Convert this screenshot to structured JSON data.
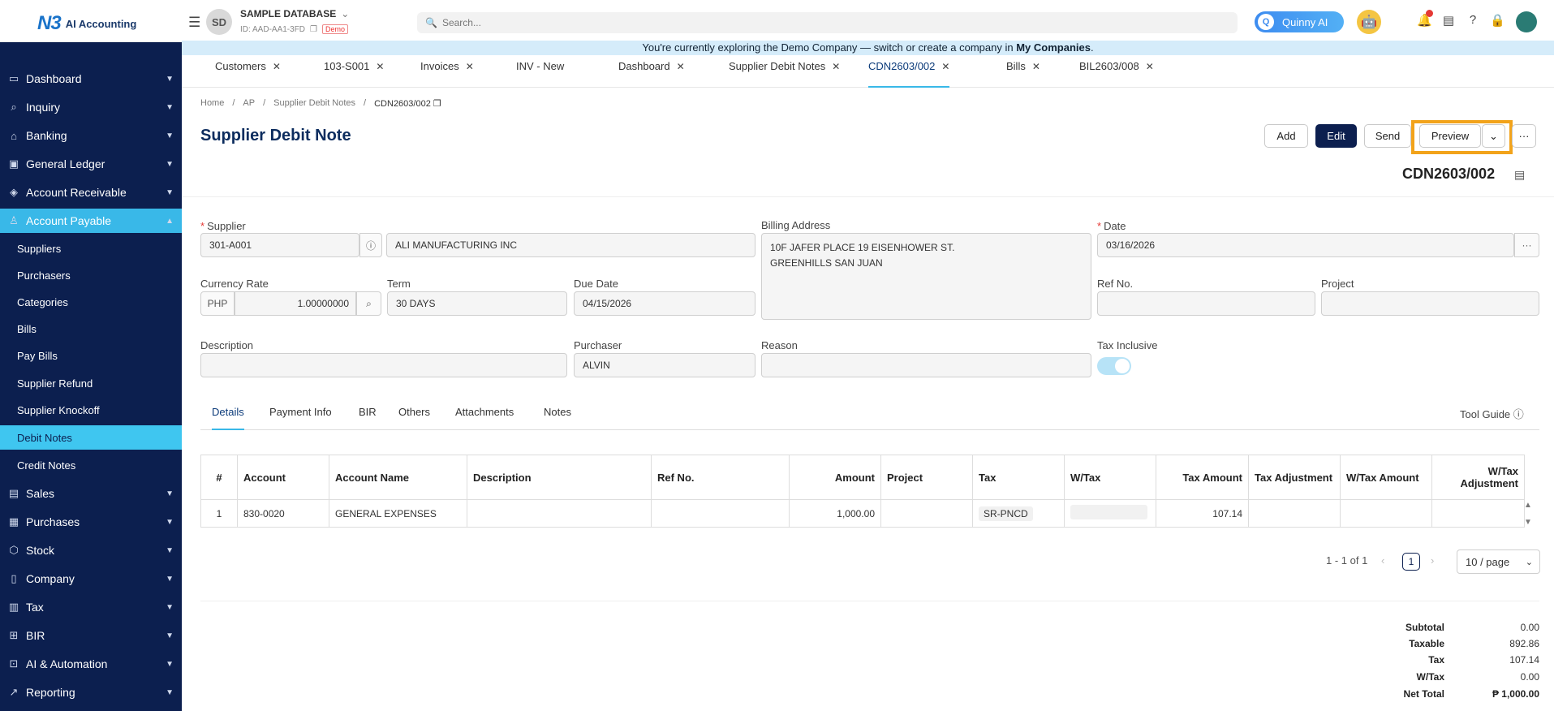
{
  "app": {
    "logo_mark": "N3",
    "logo_text": "AI Accounting"
  },
  "database": {
    "initials": "SD",
    "name": "SAMPLE DATABASE",
    "id": "ID: AAD-AA1-3FD",
    "demo_badge": "Demo"
  },
  "search": {
    "placeholder": "Search..."
  },
  "quinny": {
    "label": "Quinny AI"
  },
  "banner": {
    "text": "You're currently exploring the Demo Company — switch or create a company in ",
    "link": "My Companies",
    "suffix": "."
  },
  "tabs": [
    {
      "label": "Customers",
      "closable": true
    },
    {
      "label": "103-S001",
      "closable": true
    },
    {
      "label": "Invoices",
      "closable": true
    },
    {
      "label": "INV - New",
      "closable": false
    },
    {
      "label": "Dashboard",
      "closable": true
    },
    {
      "label": "Supplier Debit Notes",
      "closable": true
    },
    {
      "label": "CDN2603/002",
      "closable": true,
      "active": true
    },
    {
      "label": "Bills",
      "closable": true
    },
    {
      "label": "BIL2603/008",
      "closable": true
    }
  ],
  "tab_close": "✕",
  "sidebar": {
    "items": [
      {
        "label": "Dashboard",
        "icon": "monitor-icon"
      },
      {
        "label": "Inquiry",
        "icon": "inquiry-icon"
      },
      {
        "label": "Banking",
        "icon": "bank-icon"
      },
      {
        "label": "General Ledger",
        "icon": "ledger-icon"
      },
      {
        "label": "Account Receivable",
        "icon": "receivable-icon"
      },
      {
        "label": "Account Payable",
        "icon": "user-icon",
        "active": true
      },
      {
        "label": "Sales",
        "icon": "sales-icon"
      },
      {
        "label": "Purchases",
        "icon": "purchases-icon"
      },
      {
        "label": "Stock",
        "icon": "stock-icon"
      },
      {
        "label": "Company",
        "icon": "company-icon"
      },
      {
        "label": "Tax",
        "icon": "tax-icon"
      },
      {
        "label": "BIR",
        "icon": "bir-icon"
      },
      {
        "label": "AI & Automation",
        "icon": "ai-icon"
      },
      {
        "label": "Reporting",
        "icon": "chart-icon"
      }
    ],
    "sub_items": [
      {
        "label": "Suppliers"
      },
      {
        "label": "Purchasers"
      },
      {
        "label": "Categories"
      },
      {
        "label": "Bills"
      },
      {
        "label": "Pay Bills"
      },
      {
        "label": "Supplier Refund"
      },
      {
        "label": "Supplier Knockoff"
      },
      {
        "label": "Debit Notes",
        "active": true
      },
      {
        "label": "Credit Notes"
      }
    ]
  },
  "breadcrumb": [
    "Home",
    "/",
    "AP",
    "/",
    "Supplier Debit Notes",
    "/",
    "CDN2603/002"
  ],
  "page": {
    "title": "Supplier Debit Note",
    "doc_no": "CDN2603/002"
  },
  "actions": {
    "add": "Add",
    "edit": "Edit",
    "send": "Send",
    "preview": "Preview",
    "more": "···"
  },
  "form": {
    "supplier_label": "Supplier",
    "supplier_code": "301-A001",
    "supplier_name": "ALI MANUFACTURING INC",
    "billing_label": "Billing Address",
    "billing_line1": "10F JAFER PLACE 19 EISENHOWER ST.",
    "billing_line2": "GREENHILLS SAN JUAN",
    "date_label": "Date",
    "date_value": "03/16/2026",
    "currency_label": "Currency Rate",
    "currency_code": "PHP",
    "currency_rate": "1.00000000",
    "term_label": "Term",
    "term_value": "30 DAYS",
    "due_label": "Due Date",
    "due_value": "04/15/2026",
    "ref_label": "Ref No.",
    "ref_value": "",
    "project_label": "Project",
    "project_value": "",
    "description_label": "Description",
    "description_value": "",
    "purchaser_label": "Purchaser",
    "purchaser_value": "ALVIN",
    "reason_label": "Reason",
    "reason_value": "",
    "tax_inclusive_label": "Tax Inclusive",
    "tax_inclusive": true
  },
  "detail_tabs": [
    "Details",
    "Payment Info",
    "BIR",
    "Others",
    "Attachments",
    "Notes"
  ],
  "tool_guide": "Tool Guide",
  "table": {
    "headers": [
      "#",
      "Account",
      "Account Name",
      "Description",
      "Ref No.",
      "Amount",
      "Project",
      "Tax",
      "W/Tax",
      "Tax Amount",
      "Tax Adjustment",
      "W/Tax Amount",
      "W/Tax Adjustment"
    ],
    "rows": [
      [
        "1",
        "830-0020",
        "GENERAL EXPENSES",
        "",
        "",
        "1,000.00",
        "",
        "SR-PNCD",
        "",
        "107.14",
        "",
        "",
        ""
      ]
    ]
  },
  "pagination": {
    "info": "1 - 1 of 1",
    "current": "1",
    "page_size": "10 / page"
  },
  "totals": [
    {
      "label": "Subtotal",
      "value": "0.00"
    },
    {
      "label": "Taxable",
      "value": "892.86"
    },
    {
      "label": "Tax",
      "value": "107.14"
    },
    {
      "label": "W/Tax",
      "value": "0.00"
    },
    {
      "label": "Net Total",
      "value": "₱ 1,000.00"
    }
  ],
  "colors": {
    "sidebar_bg": "#0c1f4f",
    "sidebar_active": "#39b8e8",
    "highlight_border": "#f2a31b",
    "primary_button": "#0c1f4f"
  }
}
